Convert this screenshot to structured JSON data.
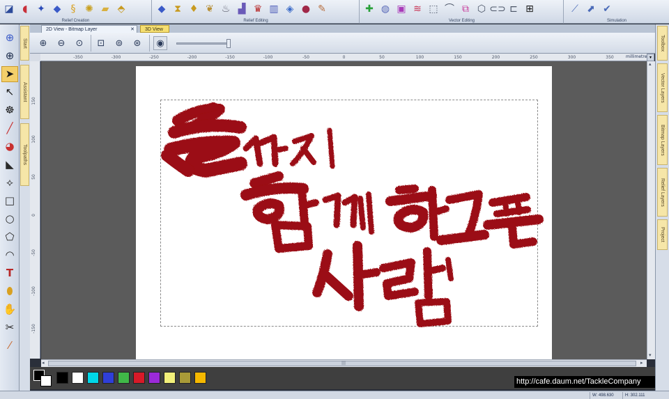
{
  "toolbar": {
    "groups": [
      {
        "label": "Relief Creation",
        "icons": [
          "relief-shape-icon",
          "relief-blob-icon",
          "star-relief-icon",
          "extrude-icon",
          "spin-icon",
          "texture-icon",
          "layer-flat-icon",
          "merge-icon"
        ]
      },
      {
        "label": "Relief Editing",
        "icons": [
          "smooth-icon",
          "hourglass-icon",
          "sculpt-icon",
          "stamp-icon",
          "cup-icon",
          "blend-icon",
          "cap-icon",
          "column-icon",
          "flatten-icon",
          "pin-icon",
          "eraser-icon"
        ]
      },
      {
        "label": "Vector Editing",
        "icons": [
          "node-edit-icon",
          "weld-icon",
          "vector-trim-icon",
          "wave-icon",
          "transform-icon",
          "bend-icon",
          "group-icon",
          "offset-icon",
          "chain-icon",
          "smooth-curve-icon",
          "centre-icon"
        ]
      },
      {
        "label": "Simulation",
        "icons": [
          "sim-3d-icon",
          "sim-toolpath-icon",
          "sim-check-icon"
        ]
      }
    ]
  },
  "left_tools": [
    "zoom-icon",
    "globe-icon",
    "select-arrow-icon",
    "node-pointer-icon",
    "measure-icon",
    "pen-icon",
    "paint-bucket-icon",
    "brush-icon",
    "vector-draw-icon",
    "rectangle-icon",
    "circle-icon",
    "polygon-icon",
    "arc-icon",
    "text-icon",
    "drop-icon",
    "clone-icon",
    "scissors-icon",
    "pipette-icon"
  ],
  "left_tabs": [
    "Start",
    "Assistant",
    "Toolpaths"
  ],
  "right_tabs": [
    "Toolbox",
    "Vector Layers",
    "Bitmap Layers",
    "Relief Layers",
    "Project"
  ],
  "view_tabs": {
    "active": "2D View - Bitmap Layer",
    "inactive": "3D View",
    "close_glyph": "✕"
  },
  "view_toolbar": {
    "buttons": [
      "zoom-in-icon",
      "zoom-out-icon",
      "zoom-fit-icon",
      "zoom-page-icon",
      "zoom-selection-icon",
      "zoom-actual-icon",
      "camera-icon"
    ]
  },
  "ruler": {
    "h_ticks": [
      "-350",
      "-300",
      "-250",
      "-200",
      "-150",
      "-100",
      "-50",
      "0",
      "50",
      "100",
      "150",
      "200",
      "250",
      "300",
      "350"
    ],
    "v_ticks": [
      "150",
      "100",
      "50",
      "0",
      "-50",
      "-100",
      "-150"
    ],
    "units": "millimetres"
  },
  "canvas": {
    "calligraphy_lines": [
      "끝까지",
      "함께하고픈",
      "사람"
    ],
    "ink_color": "#9b0d12"
  },
  "palette": {
    "colors": [
      "#000000",
      "#ffffff",
      "#00d8e8",
      "#2f3fd8",
      "#40b848",
      "#d81a28",
      "#9b2ad8",
      "#f2f07a",
      "#a89a38",
      "#f5b800"
    ]
  },
  "watermark": "http://cafe.daum.net/TackleCompany",
  "status": {
    "width": "W: 498.630",
    "height": "H: 302.111"
  }
}
